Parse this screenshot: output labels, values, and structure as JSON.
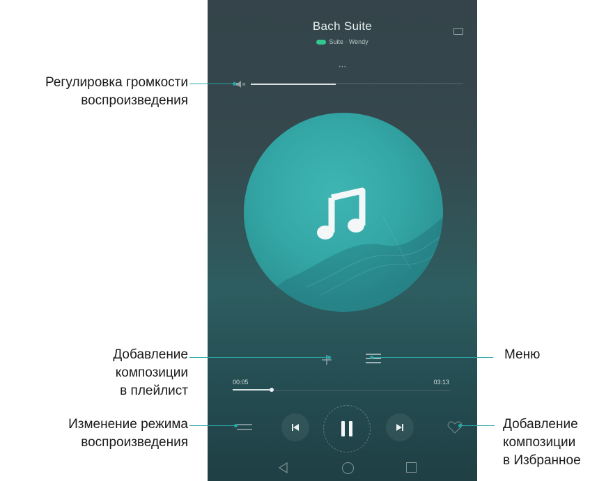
{
  "player": {
    "song_title": "Bach Suite",
    "song_subtitle": "Suite · Wendy",
    "lyrics_hint": "• • •",
    "volume_level": 0.4,
    "progress": {
      "current_time": "00:05",
      "total_time": "03:13",
      "fraction": 0.18
    },
    "colors": {
      "accent": "#2aa7a9",
      "artwork": "#34a8a7",
      "sq_badge": "#33c78f"
    },
    "icons": [
      "volume-icon",
      "music-note-icon",
      "add-icon",
      "menu-icon",
      "play-mode-icon",
      "previous-icon",
      "pause-icon",
      "next-icon",
      "heart-icon",
      "back-icon",
      "home-icon",
      "recent-apps-icon"
    ]
  },
  "callouts": {
    "volume": [
      "Регулировка громкости",
      "воспроизведения"
    ],
    "add_playlist": [
      "Добавление",
      "композиции",
      "в плейлист"
    ],
    "mode": [
      "Изменение режима",
      "воспроизведения"
    ],
    "menu": "Меню",
    "favorite": [
      "Добавление",
      "композиции",
      "в Избранное"
    ]
  }
}
